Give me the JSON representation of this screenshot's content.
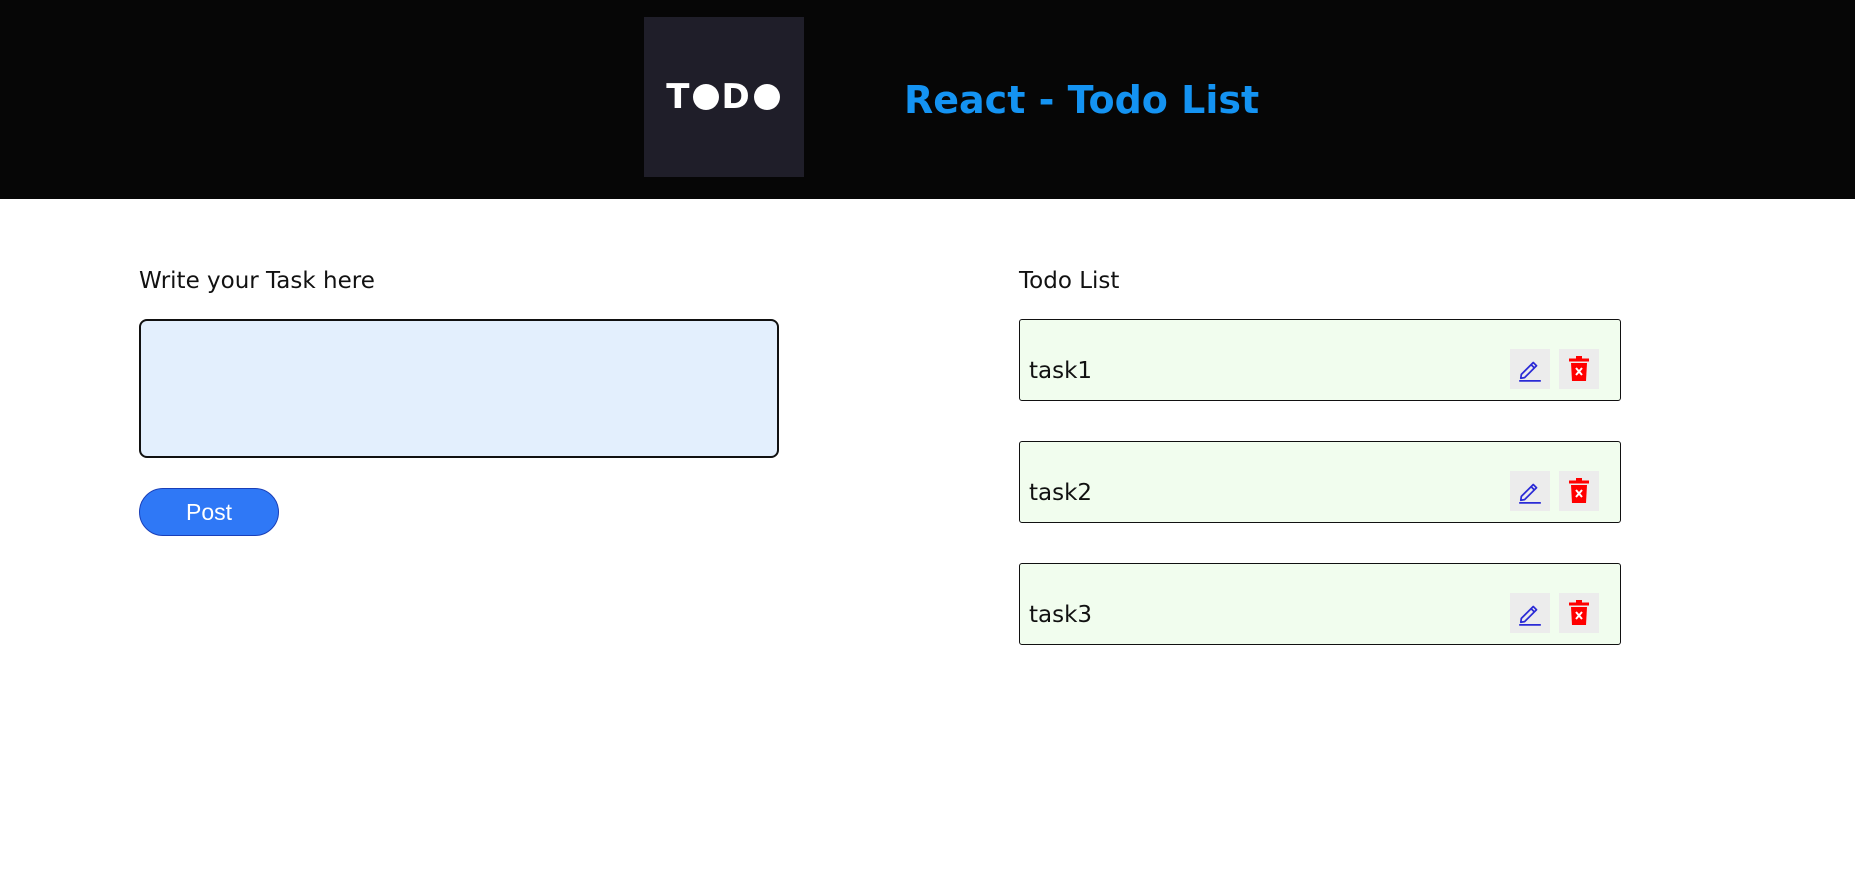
{
  "header": {
    "logo_letters": [
      "T",
      "D"
    ],
    "title": "React - Todo List",
    "title_color": "#1493f2",
    "logo_icon": "todo-logo"
  },
  "compose": {
    "label": "Write your Task here",
    "input_value": "",
    "post_label": "Post",
    "input_bg": "#e3effd",
    "button_color": "#2f78f6"
  },
  "todos": {
    "label": "Todo List",
    "items": [
      {
        "text": "task1"
      },
      {
        "text": "task2"
      },
      {
        "text": "task3"
      }
    ],
    "item_bg": "#f1fdee",
    "edit_icon": "pencil-icon",
    "delete_icon": "trash-icon",
    "edit_color": "#2b2bd6",
    "delete_color": "#ff0000"
  }
}
